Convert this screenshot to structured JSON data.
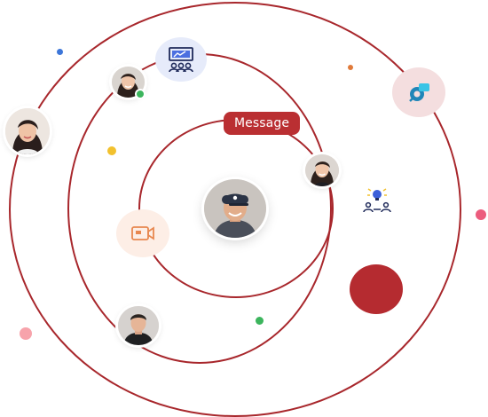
{
  "message_badge": {
    "label": "Message"
  },
  "colors": {
    "ring": "#a8272c",
    "badge": "#ba2f32",
    "big_circle": "#b52b30",
    "dot_blue": "#3d76d9",
    "dot_orange": "#e07a3a",
    "dot_yellow": "#f2c12e",
    "dot_green": "#3cb55d",
    "dot_pink": "#ec5c7d",
    "dot_light_pink": "#f7a3ab"
  },
  "icons": {
    "center": "user-avatar-icon",
    "presentation": "presentation-board-icon",
    "video": "video-camera-icon",
    "idea": "lightbulb-idea-icon",
    "brand": "brand-logo-icon"
  }
}
